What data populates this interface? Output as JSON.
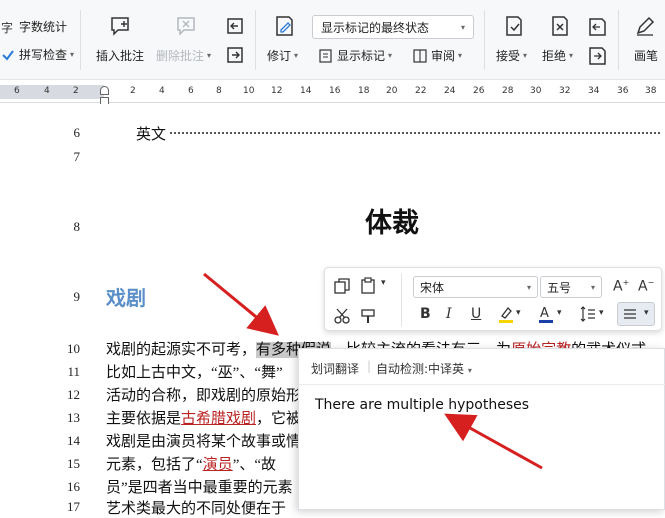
{
  "ribbon": {
    "word_count_label": "字数统计",
    "spell_check_label": "拼写检查",
    "insert_comment_label": "插入批注",
    "delete_comment_label": "删除批注",
    "track_changes_label": "修订",
    "show_markup_label": "显示标记",
    "review_label": "审阅",
    "display_mode_value": "显示标记的最终状态",
    "accept_label": "接受",
    "reject_label": "拒绝",
    "pen_label": "画笔"
  },
  "ruler": {
    "left_ticks": [
      "6",
      "4",
      "2"
    ],
    "right_ticks": [
      "2",
      "4",
      "6",
      "8",
      "10",
      "12",
      "14",
      "16",
      "18",
      "20",
      "22",
      "24",
      "26",
      "28",
      "30",
      "32",
      "34",
      "36",
      "38"
    ]
  },
  "document": {
    "line_numbers": [
      "6",
      "7",
      "8",
      "9",
      "10",
      "11",
      "12",
      "13",
      "14",
      "15",
      "16",
      "17"
    ],
    "toc_line_english": "英文",
    "title": "体裁",
    "heading": "戏剧",
    "body_lines": {
      "l10_a": "戏剧的起源实不可考，",
      "l10_b": "有多种假说",
      "l10_c": "，比较主流的看法有三。",
      "l10_d": "为",
      "l10_e": "原始宗教",
      "l10_f": "的武术仪式",
      "l11": "比如上古中文，“巫”、“舞”",
      "l12": "活动的合称，即戏剧的原始形",
      "l13_a": "主要依据是",
      "l13_b": "古希腊戏剧",
      "l13_c": "，它被",
      "l14": "戏剧是由演员将某个故事或情",
      "l15_a": "元素，包括了“",
      "l15_b": "演员",
      "l15_c": "”、“故",
      "l16": "员”是四者当中最重要的元素",
      "l17": "艺术类最大的不同处便在于"
    }
  },
  "format_bar": {
    "font_name": "宋体",
    "font_size": "五号"
  },
  "translate_popup": {
    "title": "划词翻译",
    "detect_label": "自动检测:中译英",
    "result": "There are multiple hypotheses"
  },
  "colors": {
    "heading": "#5b8fc9",
    "arrow": "#d62020",
    "selection": "#c9c9c9",
    "font_color_bar": "#1a3fa8",
    "highlight_bar": "#f5d400"
  }
}
